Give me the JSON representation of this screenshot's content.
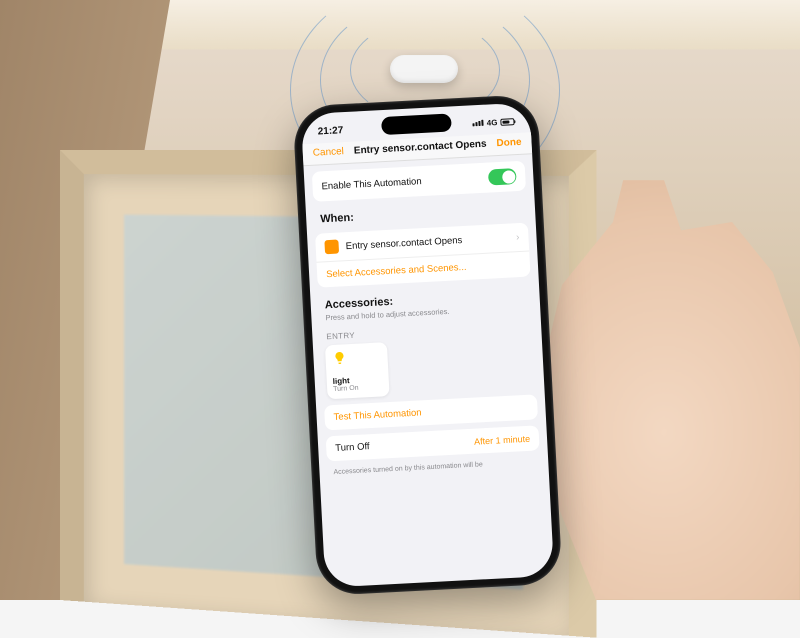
{
  "status": {
    "time": "21:27",
    "network": "4G"
  },
  "nav": {
    "cancel": "Cancel",
    "title": "Entry sensor.contact Opens",
    "done": "Done"
  },
  "enable": {
    "label": "Enable This Automation"
  },
  "when": {
    "heading": "When:",
    "item": "Entry sensor.contact Opens",
    "select": "Select Accessories and Scenes..."
  },
  "accessories": {
    "heading": "Accessories:",
    "hint": "Press and hold to adjust accessories.",
    "group": "ENTRY",
    "tile": {
      "name": "light",
      "state": "Turn On"
    },
    "test": "Test This Automation"
  },
  "turnoff": {
    "label": "Turn Off",
    "value": "After 1 minute",
    "footnote": "Accessories turned on by this automation will be"
  }
}
